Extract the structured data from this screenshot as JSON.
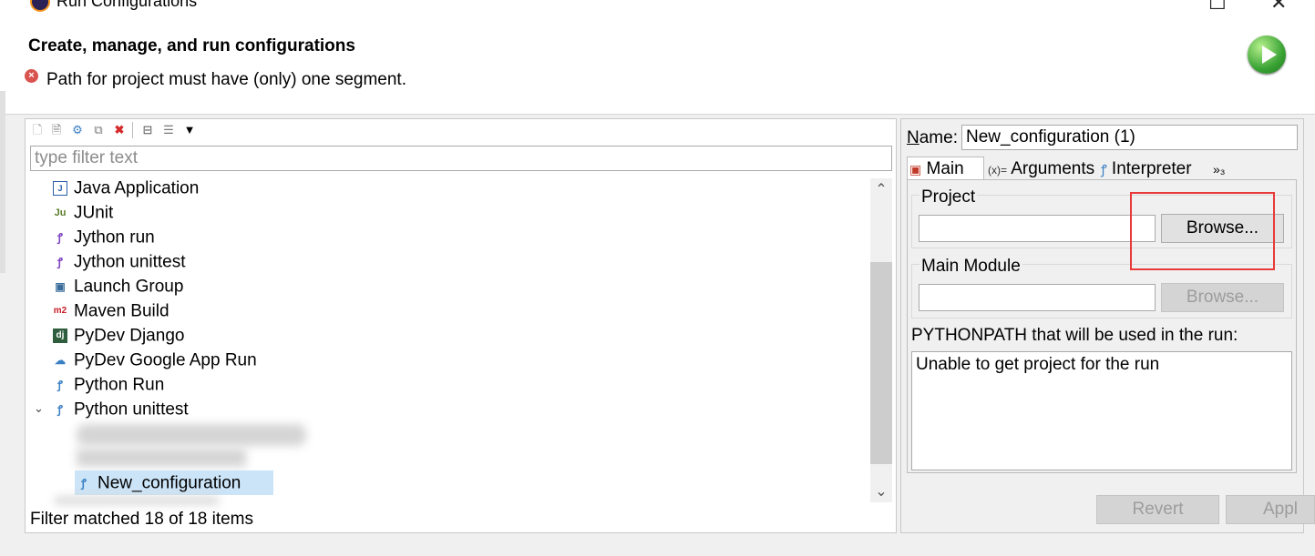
{
  "window": {
    "title": "Run Configurations"
  },
  "header": {
    "title": "Create, manage, and run configurations",
    "error": "Path for project must have (only) one segment."
  },
  "filter": {
    "placeholder": "type filter text"
  },
  "tree": [
    {
      "label": "Java Application",
      "icon": "java-app-icon"
    },
    {
      "label": "JUnit",
      "icon": "junit-icon"
    },
    {
      "label": "Jython run",
      "icon": "jython-run-icon"
    },
    {
      "label": "Jython unittest",
      "icon": "jython-unittest-icon"
    },
    {
      "label": "Launch Group",
      "icon": "launch-group-icon"
    },
    {
      "label": "Maven Build",
      "icon": "maven-icon"
    },
    {
      "label": "PyDev Django",
      "icon": "django-icon"
    },
    {
      "label": "PyDev Google App Run",
      "icon": "google-app-icon"
    },
    {
      "label": "Python Run",
      "icon": "python-run-icon"
    },
    {
      "label": "Python unittest",
      "icon": "python-unittest-icon"
    },
    {
      "label": "New_configuration",
      "icon": "python-unittest-icon"
    }
  ],
  "status": "Filter matched 18 of 18 items",
  "config": {
    "name_label_prefix": "N",
    "name_label_rest": "ame:",
    "name_value": "New_configuration (1)",
    "tabs": [
      "Main",
      "Arguments",
      "Interpreter"
    ],
    "overflow_tab": "»₃",
    "project_label": "Project",
    "project_value": "",
    "browse_label": "Browse...",
    "main_module_label": "Main Module",
    "main_module_value": "",
    "pythonpath_label": "PYTHONPATH that will be used in the run:",
    "pythonpath_value": "Unable to get project for the run",
    "revert_label": "Revert",
    "apply_label": "Appl"
  },
  "colors": {
    "highlight": "#e83a3a",
    "run_button": "#3aa335",
    "error": "#d9534f"
  }
}
